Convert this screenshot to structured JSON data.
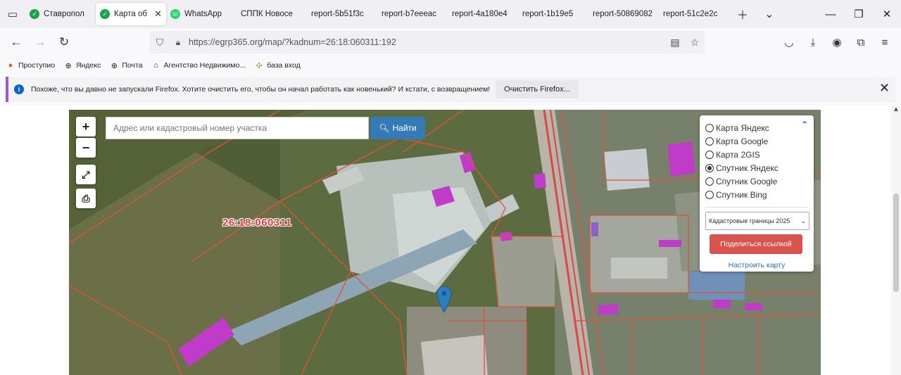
{
  "tabs": [
    {
      "label": "Ставропол",
      "favicon": "check-favicon",
      "active": false,
      "closable": false
    },
    {
      "label": "Карта об",
      "favicon": "check-favicon",
      "active": true,
      "closable": true
    },
    {
      "label": "WhatsApp",
      "favicon": "whatsapp-favicon",
      "active": false,
      "closable": false
    },
    {
      "label": "СППК Новосе",
      "favicon": "",
      "active": false,
      "closable": false
    },
    {
      "label": "report-5b51f3c",
      "favicon": "",
      "active": false,
      "closable": false
    },
    {
      "label": "report-b7eeeac",
      "favicon": "",
      "active": false,
      "closable": false
    },
    {
      "label": "report-4a180e4",
      "favicon": "",
      "active": false,
      "closable": false
    },
    {
      "label": "report-1b19e5",
      "favicon": "",
      "active": false,
      "closable": false
    },
    {
      "label": "report-50869082",
      "favicon": "",
      "active": false,
      "closable": false
    },
    {
      "label": "report-51c2e2c",
      "favicon": "",
      "active": false,
      "closable": false
    }
  ],
  "addressbar": {
    "url": "https://egrp365.org/map/?kadnum=26:18:060311:192"
  },
  "bookmarks": [
    {
      "label": "Проступио",
      "icon": "firefox-icon"
    },
    {
      "label": "Яндекс",
      "icon": "globe-icon"
    },
    {
      "label": "Почта",
      "icon": "globe-icon"
    },
    {
      "label": "Агентство Недвижимо...",
      "icon": "home-icon"
    },
    {
      "label": "база вход",
      "icon": "puzzle-icon"
    }
  ],
  "notification": {
    "message": "Похоже, что вы давно не запускали Firefox. Хотите очистить его, чтобы он начал работать как новенький? И кстати, с возвращением!",
    "button": "Очистить Firefox..."
  },
  "map": {
    "search_placeholder": "Адрес или кадастровый номер участка",
    "search_button": "Найти",
    "zoom_in": "+",
    "zoom_out": "−",
    "parcel_label": "26:18:060311",
    "layers": [
      {
        "label": "Карта Яндекс",
        "checked": false
      },
      {
        "label": "Карта Google",
        "checked": false
      },
      {
        "label": "Карта 2GIS",
        "checked": false
      },
      {
        "label": "Спутник Яндекс",
        "checked": true
      },
      {
        "label": "Спутник Google",
        "checked": false
      },
      {
        "label": "Спутник Bing",
        "checked": false
      }
    ],
    "cadastral_select": "Кадастровые границы 2025",
    "share_button": "Поделиться ссылкой",
    "setup_link": "Настроить карту"
  },
  "colors": {
    "search_button": "#337ab7",
    "share_button": "#d9534f",
    "parcel_border": "#e0533a",
    "highlighted_building": "#c03cc8"
  }
}
